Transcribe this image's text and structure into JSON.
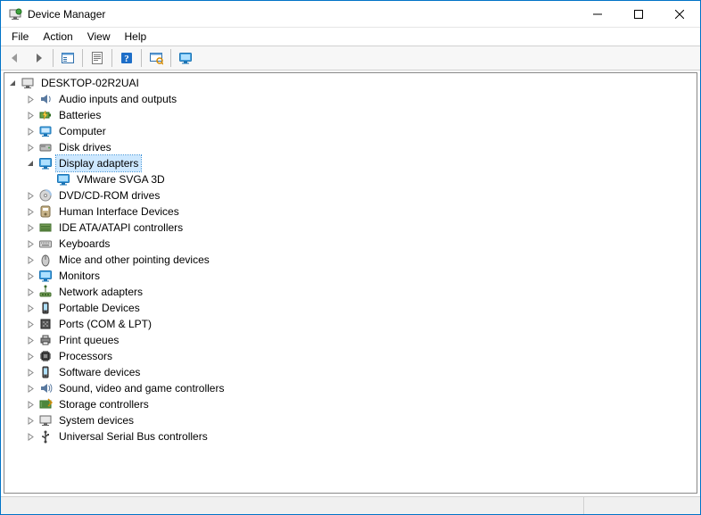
{
  "window": {
    "title": "Device Manager"
  },
  "menu": {
    "file": "File",
    "action": "Action",
    "view": "View",
    "help": "Help"
  },
  "tree": {
    "root": "DESKTOP-02R2UAI",
    "items": [
      {
        "label": "Audio inputs and outputs",
        "icon": "audio"
      },
      {
        "label": "Batteries",
        "icon": "battery"
      },
      {
        "label": "Computer",
        "icon": "computer"
      },
      {
        "label": "Disk drives",
        "icon": "disk"
      },
      {
        "label": "Display adapters",
        "icon": "display",
        "expanded": true,
        "selected": true,
        "children": [
          {
            "label": "VMware SVGA 3D",
            "icon": "display"
          }
        ]
      },
      {
        "label": "DVD/CD-ROM drives",
        "icon": "dvd"
      },
      {
        "label": "Human Interface Devices",
        "icon": "hid"
      },
      {
        "label": "IDE ATA/ATAPI controllers",
        "icon": "ide"
      },
      {
        "label": "Keyboards",
        "icon": "keyboard"
      },
      {
        "label": "Mice and other pointing devices",
        "icon": "mouse"
      },
      {
        "label": "Monitors",
        "icon": "monitor"
      },
      {
        "label": "Network adapters",
        "icon": "network"
      },
      {
        "label": "Portable Devices",
        "icon": "portable"
      },
      {
        "label": "Ports (COM & LPT)",
        "icon": "port"
      },
      {
        "label": "Print queues",
        "icon": "printer"
      },
      {
        "label": "Processors",
        "icon": "cpu"
      },
      {
        "label": "Software devices",
        "icon": "software"
      },
      {
        "label": "Sound, video and game controllers",
        "icon": "sound"
      },
      {
        "label": "Storage controllers",
        "icon": "storage"
      },
      {
        "label": "System devices",
        "icon": "system"
      },
      {
        "label": "Universal Serial Bus controllers",
        "icon": "usb"
      }
    ]
  }
}
